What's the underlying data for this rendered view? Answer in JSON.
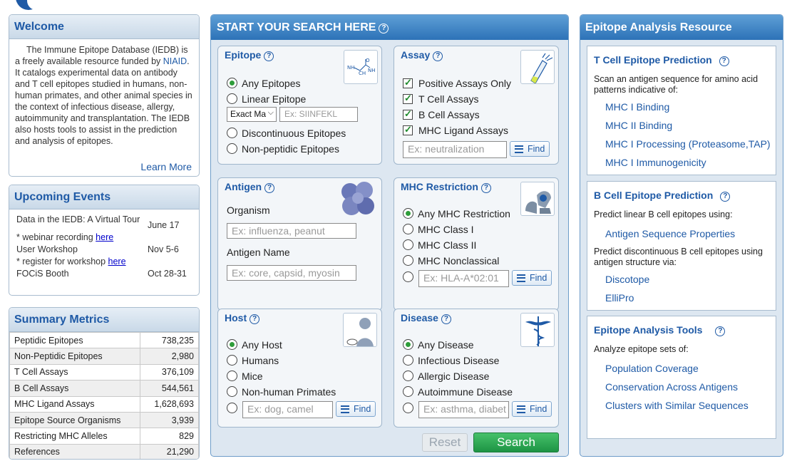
{
  "welcome": {
    "title": "Welcome",
    "text_before_link": "The Immune Epitope Database (IEDB) is a freely available resource funded by ",
    "link": "NIAID",
    "text_after_link": ". It catalogs experimental data on antibody and T cell epitopes studied in humans, non-human primates, and other animal species in the context of infectious disease, allergy, autoimmunity and transplantation. The IEDB also hosts tools to assist in the prediction and analysis of epitopes.",
    "learn_more": "Learn More"
  },
  "events": {
    "title": "Upcoming Events",
    "items": [
      {
        "name": "Data in the IEDB: A Virtual Tour",
        "date": "June 17",
        "note_prefix": "* webinar recording ",
        "note_link": "here"
      },
      {
        "name": "User Workshop",
        "date": "Nov 5-6",
        "note_prefix": "* register for workshop ",
        "note_link": "here"
      },
      {
        "name": "FOCiS Booth",
        "date": "Oct 28-31"
      }
    ]
  },
  "metrics": {
    "title": "Summary Metrics",
    "rows": [
      {
        "label": "Peptidic Epitopes",
        "value": "738,235"
      },
      {
        "label": "Non-Peptidic Epitopes",
        "value": "2,980"
      },
      {
        "label": "T Cell Assays",
        "value": "376,109"
      },
      {
        "label": "B Cell Assays",
        "value": "544,561"
      },
      {
        "label": "MHC Ligand Assays",
        "value": "1,628,693"
      },
      {
        "label": "Epitope Source Organisms",
        "value": "3,939"
      },
      {
        "label": "Restricting MHC Alleles",
        "value": "829"
      },
      {
        "label": "References",
        "value": "21,290"
      }
    ]
  },
  "search": {
    "title": "START YOUR SEARCH HERE",
    "help": "?",
    "epitope": {
      "title": "Epitope",
      "options": [
        "Any Epitopes",
        "Linear Epitope",
        "Discontinuous Epitopes",
        "Non-peptidic Epitopes"
      ],
      "match_select": "Exact Ma",
      "sequence_placeholder": "Ex: SIINFEKL"
    },
    "assay": {
      "title": "Assay",
      "options": [
        "Positive Assays Only",
        "T Cell Assays",
        "B Cell Assays",
        "MHC Ligand Assays"
      ],
      "placeholder": "Ex: neutralization",
      "find": "Find"
    },
    "antigen": {
      "title": "Antigen",
      "organism_label": "Organism",
      "organism_placeholder": "Ex: influenza, peanut",
      "name_label": "Antigen Name",
      "name_placeholder": "Ex: core, capsid, myosin"
    },
    "mhc": {
      "title": "MHC Restriction",
      "options": [
        "Any MHC Restriction",
        "MHC Class I",
        "MHC Class II",
        "MHC Nonclassical"
      ],
      "placeholder": "Ex: HLA-A*02:01",
      "find": "Find"
    },
    "host": {
      "title": "Host",
      "options": [
        "Any Host",
        "Humans",
        "Mice",
        "Non-human Primates"
      ],
      "placeholder": "Ex: dog, camel",
      "find": "Find"
    },
    "disease": {
      "title": "Disease",
      "options": [
        "Any Disease",
        "Infectious Disease",
        "Allergic Disease",
        "Autoimmune Disease"
      ],
      "placeholder": "Ex: asthma, diabet",
      "find": "Find"
    },
    "reset": "Reset",
    "search": "Search"
  },
  "analysis": {
    "title": "Epitope Analysis Resource",
    "tcell": {
      "title": "T Cell Epitope Prediction",
      "text": "Scan an antigen sequence for amino acid patterns indicative of:",
      "links": [
        "MHC I Binding",
        "MHC II Binding",
        "MHC I Processing (Proteasome,TAP)",
        "MHC I Immunogenicity"
      ]
    },
    "bcell": {
      "title": "B Cell Epitope Prediction",
      "text1": "Predict linear B cell epitopes using:",
      "link1": "Antigen Sequence Properties",
      "text2": "Predict discontinuous B cell epitopes using antigen structure via:",
      "links2": [
        "Discotope",
        "ElliPro"
      ]
    },
    "tools": {
      "title": "Epitope Analysis Tools",
      "text": "Analyze epitope sets of:",
      "links": [
        "Population Coverage",
        "Conservation Across Antigens",
        "Clusters with Similar Sequences"
      ]
    }
  }
}
